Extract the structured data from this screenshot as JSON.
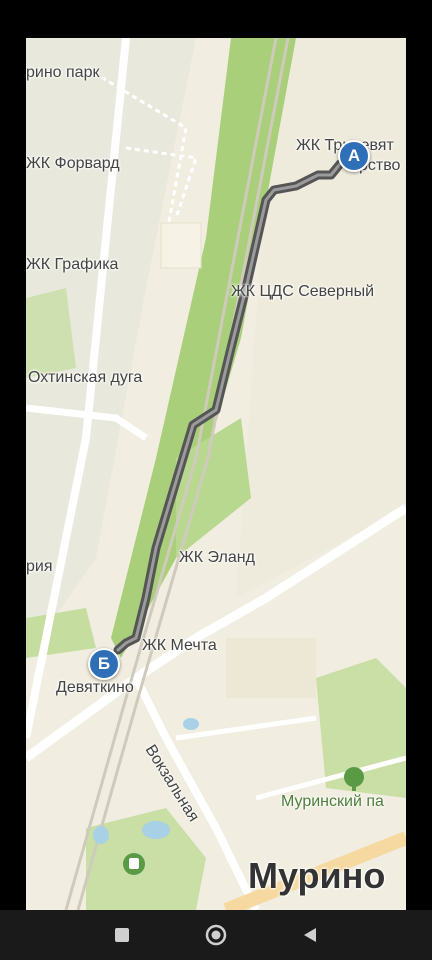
{
  "map": {
    "labels": {
      "murino_park_top": "рино парк",
      "forward": "ЖК Форвард",
      "tridevyatoe": "ЖК Тридевят",
      "tridevyatoe_line2": "рство",
      "grafika": "ЖК Графика",
      "tsds": "ЖК ЦДС Северный",
      "okhtinskaya": "Охтинская дуга",
      "eland": "ЖК Эланд",
      "riya": "рия",
      "mechta": "ЖК Мечта",
      "devyatkino": "Девяткино",
      "vokzalnaya": "Вокзальная",
      "murinsky_park": "Муринский па",
      "murino": "Мурино"
    },
    "markers": {
      "start": "А",
      "end": "Б"
    },
    "colors": {
      "route": "#555555",
      "marker": "#2f6fb8",
      "park": "#c9dfa6",
      "railway_green": "#a9cf7a"
    }
  },
  "navbar": {
    "icons": [
      "recent-apps-icon",
      "home-icon",
      "back-icon"
    ]
  }
}
